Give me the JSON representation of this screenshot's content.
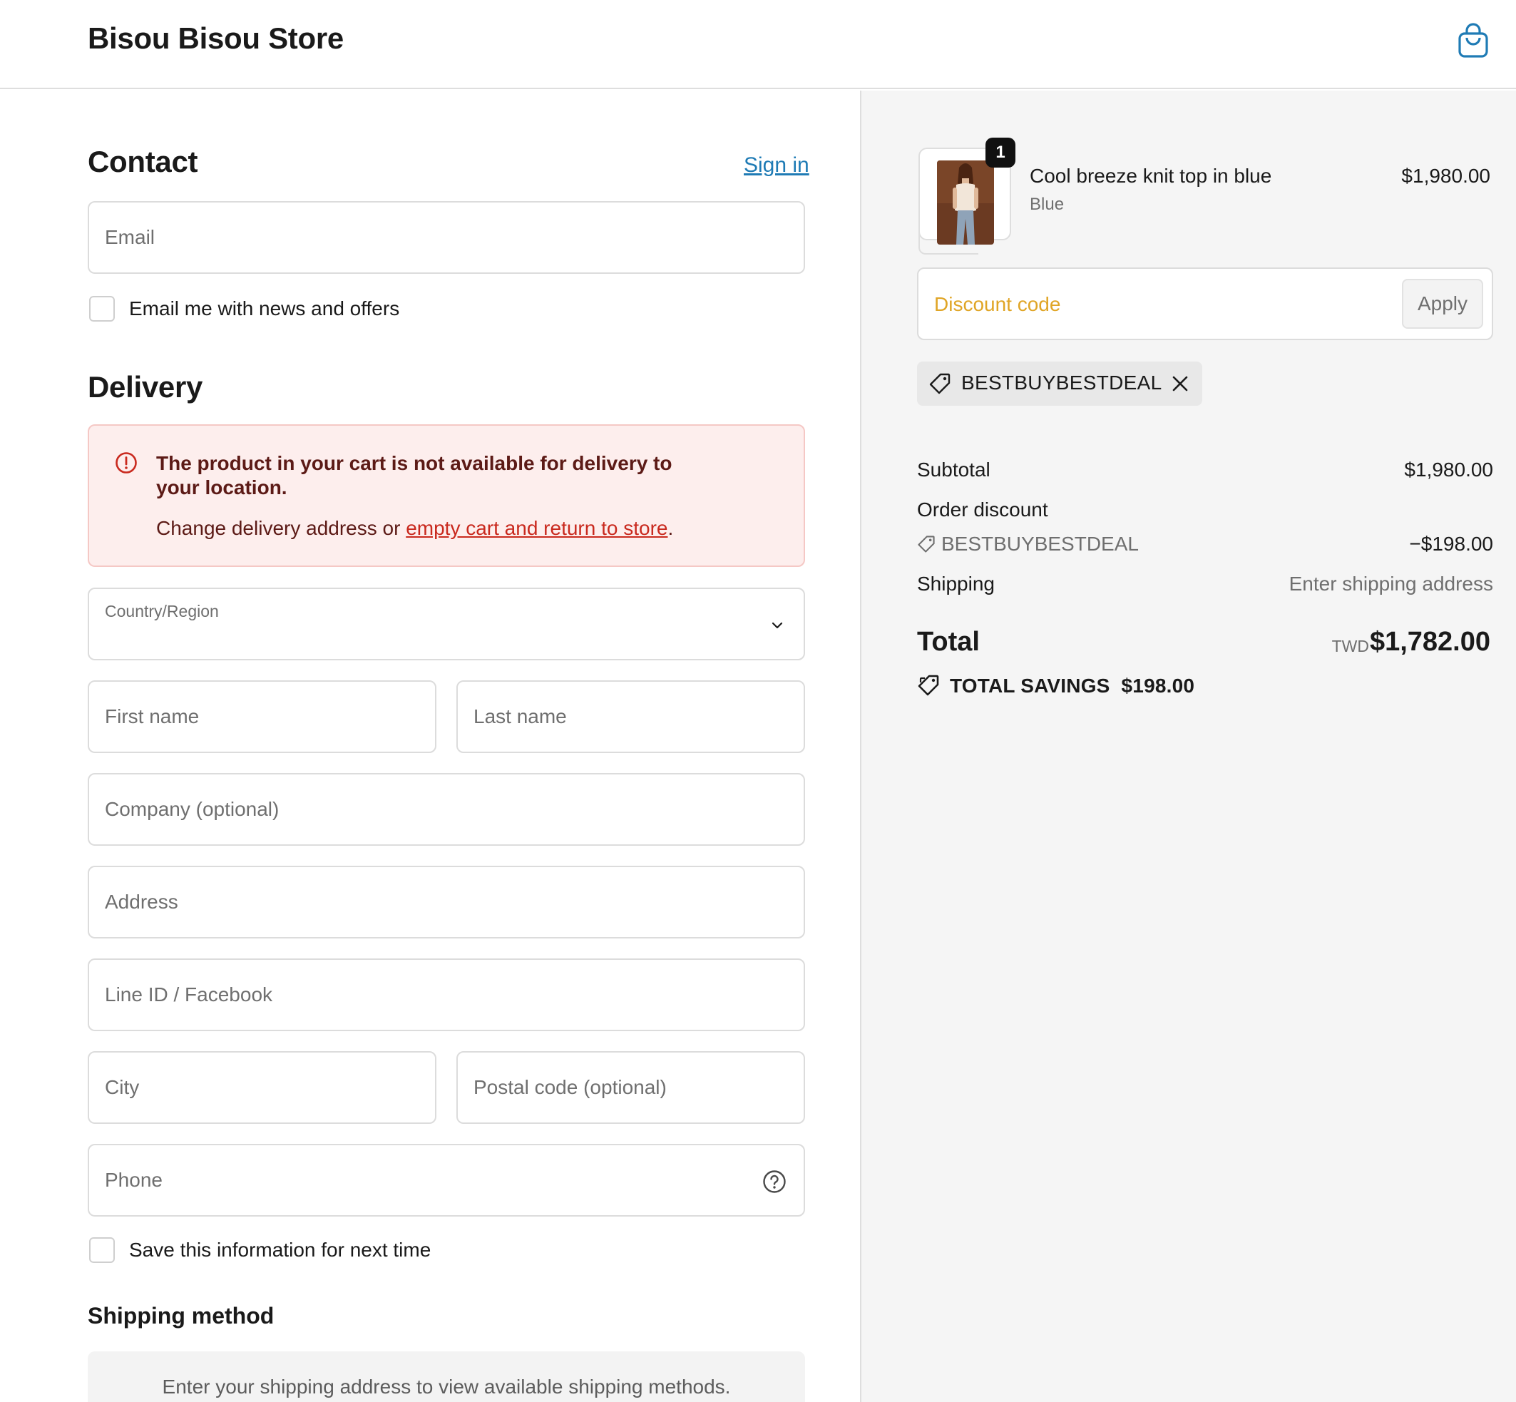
{
  "header": {
    "store_name": "Bisou Bisou Store"
  },
  "contact": {
    "title": "Contact",
    "sign_in": "Sign in",
    "email_placeholder": "Email",
    "newsletter_label": "Email me with news and offers"
  },
  "delivery": {
    "title": "Delivery",
    "alert_title": "The product in your cart is not available for delivery to your location.",
    "alert_prefix": "Change delivery address or ",
    "alert_link": "empty cart and return to store",
    "alert_suffix": ".",
    "country_label": "Country/Region",
    "first_name": "First name",
    "last_name": "Last name",
    "company": "Company (optional)",
    "address": "Address",
    "line_id": "Line ID / Facebook",
    "city": "City",
    "postal": "Postal code (optional)",
    "phone": "Phone",
    "save_info_label": "Save this information for next time"
  },
  "shipping_method": {
    "title": "Shipping method",
    "placeholder": "Enter your shipping address to view available shipping methods."
  },
  "cart": {
    "item": {
      "quantity": "1",
      "name": "Cool breeze knit top in blue",
      "variant": "Blue",
      "price": "$1,980.00"
    },
    "discount_placeholder": "Discount code",
    "apply_label": "Apply",
    "applied_code": "BESTBUYBESTDEAL"
  },
  "summary": {
    "subtotal_label": "Subtotal",
    "subtotal_value": "$1,980.00",
    "order_discount_label": "Order discount",
    "discount_code": "BESTBUYBESTDEAL",
    "discount_value": "−$198.00",
    "shipping_label": "Shipping",
    "shipping_value": "Enter shipping address",
    "total_label": "Total",
    "currency": "TWD",
    "total_value": "$1,782.00",
    "savings_label": "TOTAL SAVINGS",
    "savings_value": "$198.00"
  },
  "colors": {
    "link_blue": "#1f7bb5",
    "error_text": "#5c1a16",
    "error_link": "#c9291e",
    "error_bg": "#fdeeed",
    "discount_placeholder": "#e0a526"
  }
}
